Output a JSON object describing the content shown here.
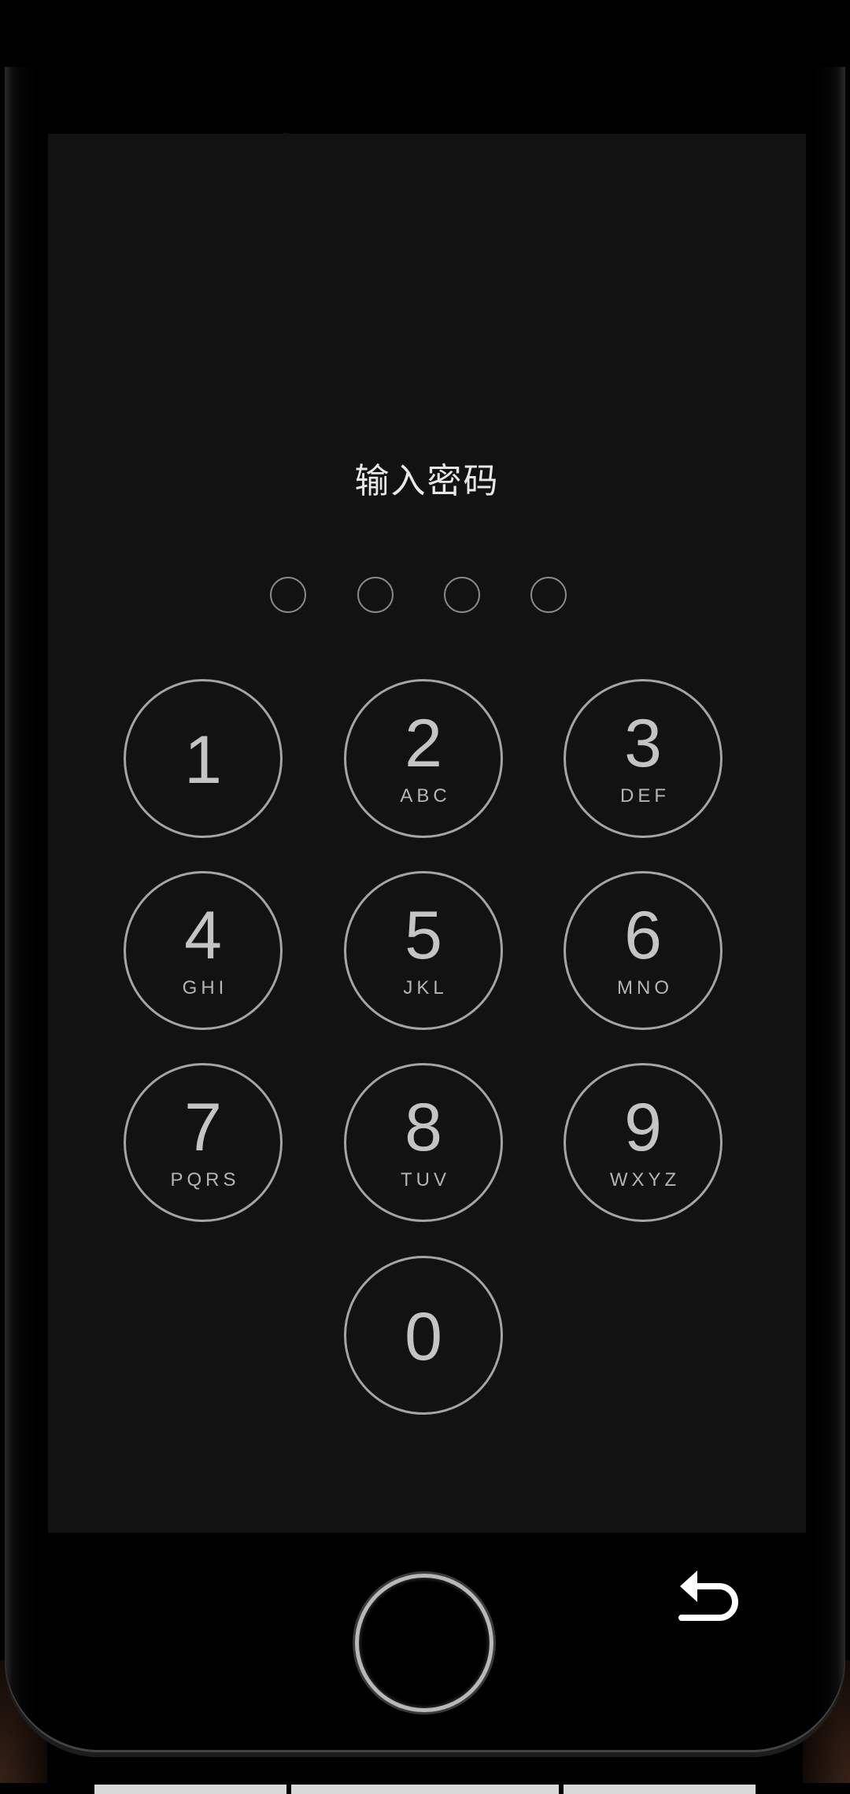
{
  "screen": {
    "title": "输入密码",
    "passcode_length": 4,
    "entered_digits": 0
  },
  "keypad": {
    "keys": [
      {
        "digit": "1",
        "letters": ""
      },
      {
        "digit": "2",
        "letters": "ABC"
      },
      {
        "digit": "3",
        "letters": "DEF"
      },
      {
        "digit": "4",
        "letters": "GHI"
      },
      {
        "digit": "5",
        "letters": "JKL"
      },
      {
        "digit": "6",
        "letters": "MNO"
      },
      {
        "digit": "7",
        "letters": "PQRS"
      },
      {
        "digit": "8",
        "letters": "TUV"
      },
      {
        "digit": "9",
        "letters": "WXYZ"
      },
      {
        "digit": "0",
        "letters": ""
      }
    ]
  },
  "icons": {
    "back": "back-arrow-icon",
    "home": "home-button"
  },
  "colors": {
    "screen_bg": "#121212",
    "key_ring": "#a5a5a5",
    "title_text": "#e8e8e8",
    "dot_ring": "#8a8a8a"
  }
}
